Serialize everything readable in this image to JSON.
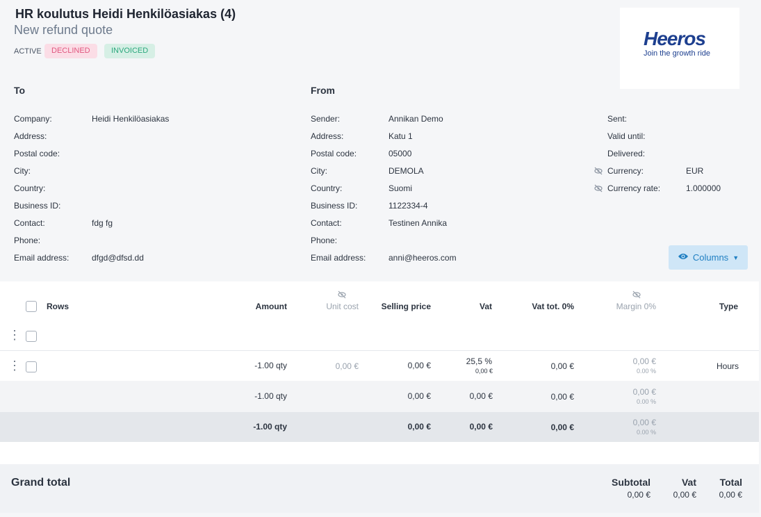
{
  "header": {
    "title": "HR koulutus Heidi Henkilöasiakas (4)",
    "subtitle": "New refund quote",
    "status": "ACTIVE",
    "badges": [
      "DECLINED",
      "INVOICED"
    ],
    "logo_text": "Heeros",
    "logo_tagline": "Join the growth ride"
  },
  "to": {
    "heading": "To",
    "fields": [
      {
        "label": "Company:",
        "value": "Heidi Henkilöasiakas"
      },
      {
        "label": "Address:",
        "value": ""
      },
      {
        "label": "Postal code:",
        "value": ""
      },
      {
        "label": "City:",
        "value": ""
      },
      {
        "label": "Country:",
        "value": ""
      },
      {
        "label": "Business ID:",
        "value": ""
      },
      {
        "label": "Contact:",
        "value": "fdg fg"
      },
      {
        "label": "Phone:",
        "value": ""
      },
      {
        "label": "Email address:",
        "value": "dfgd@dfsd.dd"
      }
    ]
  },
  "from": {
    "heading": "From",
    "fields": [
      {
        "label": "Sender:",
        "value": "Annikan Demo"
      },
      {
        "label": "Address:",
        "value": "Katu 1"
      },
      {
        "label": "Postal code:",
        "value": "05000"
      },
      {
        "label": "City:",
        "value": "DEMOLA"
      },
      {
        "label": "Country:",
        "value": "Suomi"
      },
      {
        "label": "Business ID:",
        "value": "1122334-4"
      },
      {
        "label": "Contact:",
        "value": "Testinen Annika"
      },
      {
        "label": "Phone:",
        "value": ""
      },
      {
        "label": "Email address:",
        "value": "anni@heeros.com"
      }
    ]
  },
  "meta": {
    "fields": [
      {
        "label": "Sent:",
        "value": "",
        "icon": ""
      },
      {
        "label": "Valid until:",
        "value": "",
        "icon": ""
      },
      {
        "label": "Delivered:",
        "value": "",
        "icon": ""
      },
      {
        "label": "Currency:",
        "value": "EUR",
        "icon": "eye-off-icon"
      },
      {
        "label": "Currency rate:",
        "value": "1.000000",
        "icon": "eye-off-icon"
      }
    ]
  },
  "columns_button": {
    "label": "Columns",
    "icon": "eye-icon"
  },
  "table": {
    "headers": {
      "rows": "Rows",
      "amount": "Amount",
      "unit_cost": "Unit cost",
      "selling_price": "Selling price",
      "vat": "Vat",
      "vat_tot": "Vat tot. 0%",
      "margin": "Margin 0%",
      "type": "Type"
    },
    "row1": {
      "amount": "-1.00 qty",
      "unit_cost": "0,00 €",
      "selling_price": "0,00 €",
      "vat_pct": "25,5 %",
      "vat_amount": "0,00 €",
      "vat_tot": "0,00 €",
      "margin": "0,00 €",
      "margin_pct": "0.00 %",
      "type": "Hours"
    },
    "subtotal": {
      "amount": "-1.00 qty",
      "selling_price": "0,00 €",
      "vat": "0,00 €",
      "vat_tot": "0,00 €",
      "margin": "0,00 €",
      "margin_pct": "0.00 %"
    },
    "total": {
      "amount": "-1.00 qty",
      "selling_price": "0,00 €",
      "vat": "0,00 €",
      "vat_tot": "0,00 €",
      "margin": "0,00 €",
      "margin_pct": "0.00 %"
    }
  },
  "grand_total": {
    "title": "Grand total",
    "subtotal_label": "Subtotal",
    "subtotal_value": "0,00 €",
    "vat_label": "Vat",
    "vat_value": "0,00 €",
    "total_label": "Total",
    "total_value": "0,00 €"
  }
}
